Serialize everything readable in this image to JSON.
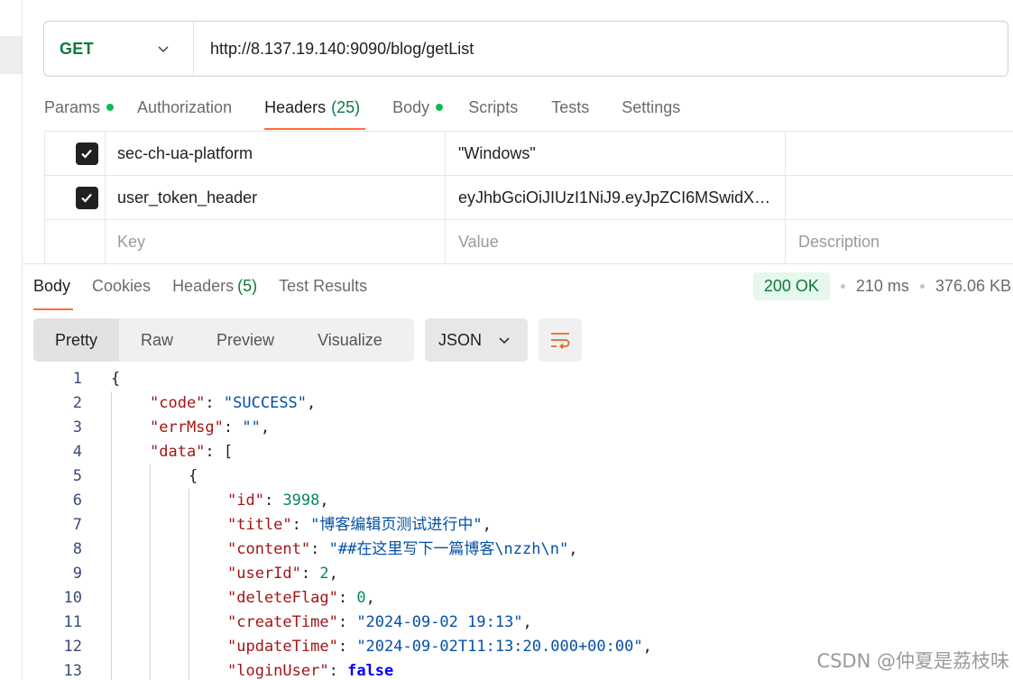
{
  "request": {
    "method": "GET",
    "url": "http://8.137.19.140:9090/blog/getList"
  },
  "request_tabs": [
    {
      "label": "Params",
      "has_dot": true
    },
    {
      "label": "Authorization"
    },
    {
      "label": "Headers",
      "count": "(25)",
      "active": true
    },
    {
      "label": "Body",
      "has_dot": true
    },
    {
      "label": "Scripts"
    },
    {
      "label": "Tests"
    },
    {
      "label": "Settings"
    }
  ],
  "headers_table": {
    "rows": [
      {
        "checked": true,
        "key": "sec-ch-ua-platform",
        "value": "\"Windows\"",
        "description": ""
      },
      {
        "checked": true,
        "key": "user_token_header",
        "value": "eyJhbGciOiJIUzI1NiJ9.eyJpZCI6MSwidX…",
        "description": ""
      }
    ],
    "placeholders": {
      "key": "Key",
      "value": "Value",
      "description": "Description"
    }
  },
  "response_tabs": [
    {
      "label": "Body",
      "active": true
    },
    {
      "label": "Cookies"
    },
    {
      "label": "Headers",
      "count": "(5)"
    },
    {
      "label": "Test Results"
    }
  ],
  "response_status": {
    "status": "200 OK",
    "time": "210 ms",
    "size": "376.06 KB"
  },
  "view_modes": [
    "Pretty",
    "Raw",
    "Preview",
    "Visualize"
  ],
  "format_select": "JSON",
  "code_lines": [
    {
      "n": "1",
      "indent": 0,
      "parts": [
        [
          "p",
          "{"
        ]
      ]
    },
    {
      "n": "2",
      "indent": 1,
      "parts": [
        [
          "k",
          "\"code\""
        ],
        [
          "p",
          ": "
        ],
        [
          "s",
          "\"SUCCESS\""
        ],
        [
          "p",
          ","
        ]
      ]
    },
    {
      "n": "3",
      "indent": 1,
      "parts": [
        [
          "k",
          "\"errMsg\""
        ],
        [
          "p",
          ": "
        ],
        [
          "s",
          "\"\""
        ],
        [
          "p",
          ","
        ]
      ]
    },
    {
      "n": "4",
      "indent": 1,
      "parts": [
        [
          "k",
          "\"data\""
        ],
        [
          "p",
          ": ["
        ]
      ]
    },
    {
      "n": "5",
      "indent": 2,
      "parts": [
        [
          "p",
          "{"
        ]
      ]
    },
    {
      "n": "6",
      "indent": 3,
      "parts": [
        [
          "k",
          "\"id\""
        ],
        [
          "p",
          ": "
        ],
        [
          "n",
          "3998"
        ],
        [
          "p",
          ","
        ]
      ]
    },
    {
      "n": "7",
      "indent": 3,
      "parts": [
        [
          "k",
          "\"title\""
        ],
        [
          "p",
          ": "
        ],
        [
          "s",
          "\"博客编辑页测试进行中\""
        ],
        [
          "p",
          ","
        ]
      ]
    },
    {
      "n": "8",
      "indent": 3,
      "parts": [
        [
          "k",
          "\"content\""
        ],
        [
          "p",
          ": "
        ],
        [
          "s",
          "\"##在这里写下一篇博客\\nzzh\\n\""
        ],
        [
          "p",
          ","
        ]
      ]
    },
    {
      "n": "9",
      "indent": 3,
      "parts": [
        [
          "k",
          "\"userId\""
        ],
        [
          "p",
          ": "
        ],
        [
          "n",
          "2"
        ],
        [
          "p",
          ","
        ]
      ]
    },
    {
      "n": "10",
      "indent": 3,
      "parts": [
        [
          "k",
          "\"deleteFlag\""
        ],
        [
          "p",
          ": "
        ],
        [
          "n",
          "0"
        ],
        [
          "p",
          ","
        ]
      ]
    },
    {
      "n": "11",
      "indent": 3,
      "parts": [
        [
          "k",
          "\"createTime\""
        ],
        [
          "p",
          ": "
        ],
        [
          "s",
          "\"2024-09-02 19:13\""
        ],
        [
          "p",
          ","
        ]
      ]
    },
    {
      "n": "12",
      "indent": 3,
      "parts": [
        [
          "k",
          "\"updateTime\""
        ],
        [
          "p",
          ": "
        ],
        [
          "s",
          "\"2024-09-02T11:13:20.000+00:00\""
        ],
        [
          "p",
          ","
        ]
      ]
    },
    {
      "n": "13",
      "indent": 3,
      "parts": [
        [
          "k",
          "\"loginUser\""
        ],
        [
          "p",
          ": "
        ],
        [
          "b",
          "false"
        ]
      ]
    }
  ],
  "watermark": "CSDN @仲夏是荔枝味",
  "colors": {
    "accent": "#ff6c37",
    "get_method": "#0b7a3e",
    "dot": "#0cbb52"
  },
  "icons": [
    "chevron-down-icon",
    "checkbox-checked-icon",
    "wrap-lines-icon"
  ]
}
